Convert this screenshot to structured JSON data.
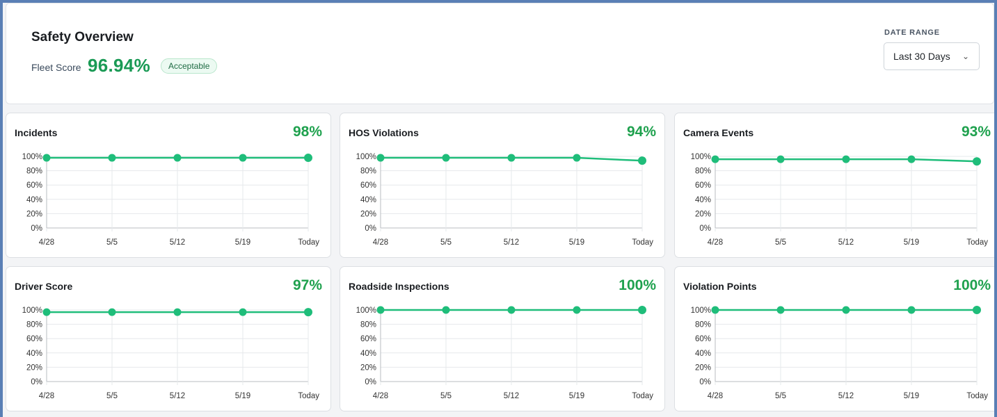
{
  "header": {
    "title": "Safety Overview",
    "fleet_label": "Fleet Score",
    "fleet_value": "96.94%",
    "fleet_badge": "Acceptable",
    "date_label": "DATE RANGE",
    "date_value": "Last 30 Days",
    "chevron_icon": "chevron-down-icon"
  },
  "colors": {
    "accent_green": "#1fa14e",
    "line_green": "#1fbd7a",
    "fleet_green": "#1a9a55"
  },
  "chart_data": [
    {
      "type": "line",
      "title": "Incidents",
      "score": "98%",
      "x": [
        "4/28",
        "5/5",
        "5/12",
        "5/19",
        "Today"
      ],
      "series": [
        {
          "values": [
            98,
            98,
            98,
            98,
            98
          ]
        }
      ],
      "y_ticks": [
        "100%",
        "80%",
        "60%",
        "40%",
        "20%",
        "0%"
      ],
      "ylim": [
        0,
        100
      ],
      "grid": true
    },
    {
      "type": "line",
      "title": "HOS Violations",
      "score": "94%",
      "x": [
        "4/28",
        "5/5",
        "5/12",
        "5/19",
        "Today"
      ],
      "series": [
        {
          "values": [
            98,
            98,
            98,
            98,
            94
          ]
        }
      ],
      "y_ticks": [
        "100%",
        "80%",
        "60%",
        "40%",
        "20%",
        "0%"
      ],
      "ylim": [
        0,
        100
      ],
      "grid": true
    },
    {
      "type": "line",
      "title": "Camera Events",
      "score": "93%",
      "x": [
        "4/28",
        "5/5",
        "5/12",
        "5/19",
        "Today"
      ],
      "series": [
        {
          "values": [
            96,
            96,
            96,
            96,
            93
          ]
        }
      ],
      "y_ticks": [
        "100%",
        "80%",
        "60%",
        "40%",
        "20%",
        "0%"
      ],
      "ylim": [
        0,
        100
      ],
      "grid": true
    },
    {
      "type": "line",
      "title": "Driver Score",
      "score": "97%",
      "x": [
        "4/28",
        "5/5",
        "5/12",
        "5/19",
        "Today"
      ],
      "series": [
        {
          "values": [
            97,
            97,
            97,
            97,
            97
          ]
        }
      ],
      "y_ticks": [
        "100%",
        "80%",
        "60%",
        "40%",
        "20%",
        "0%"
      ],
      "ylim": [
        0,
        100
      ],
      "grid": true
    },
    {
      "type": "line",
      "title": "Roadside Inspections",
      "score": "100%",
      "x": [
        "4/28",
        "5/5",
        "5/12",
        "5/19",
        "Today"
      ],
      "series": [
        {
          "values": [
            100,
            100,
            100,
            100,
            100
          ]
        }
      ],
      "y_ticks": [
        "100%",
        "80%",
        "60%",
        "40%",
        "20%",
        "0%"
      ],
      "ylim": [
        0,
        100
      ],
      "grid": true
    },
    {
      "type": "line",
      "title": "Violation Points",
      "score": "100%",
      "x": [
        "4/28",
        "5/5",
        "5/12",
        "5/19",
        "Today"
      ],
      "series": [
        {
          "values": [
            100,
            100,
            100,
            100,
            100
          ]
        }
      ],
      "y_ticks": [
        "100%",
        "80%",
        "60%",
        "40%",
        "20%",
        "0%"
      ],
      "ylim": [
        0,
        100
      ],
      "grid": true
    }
  ]
}
